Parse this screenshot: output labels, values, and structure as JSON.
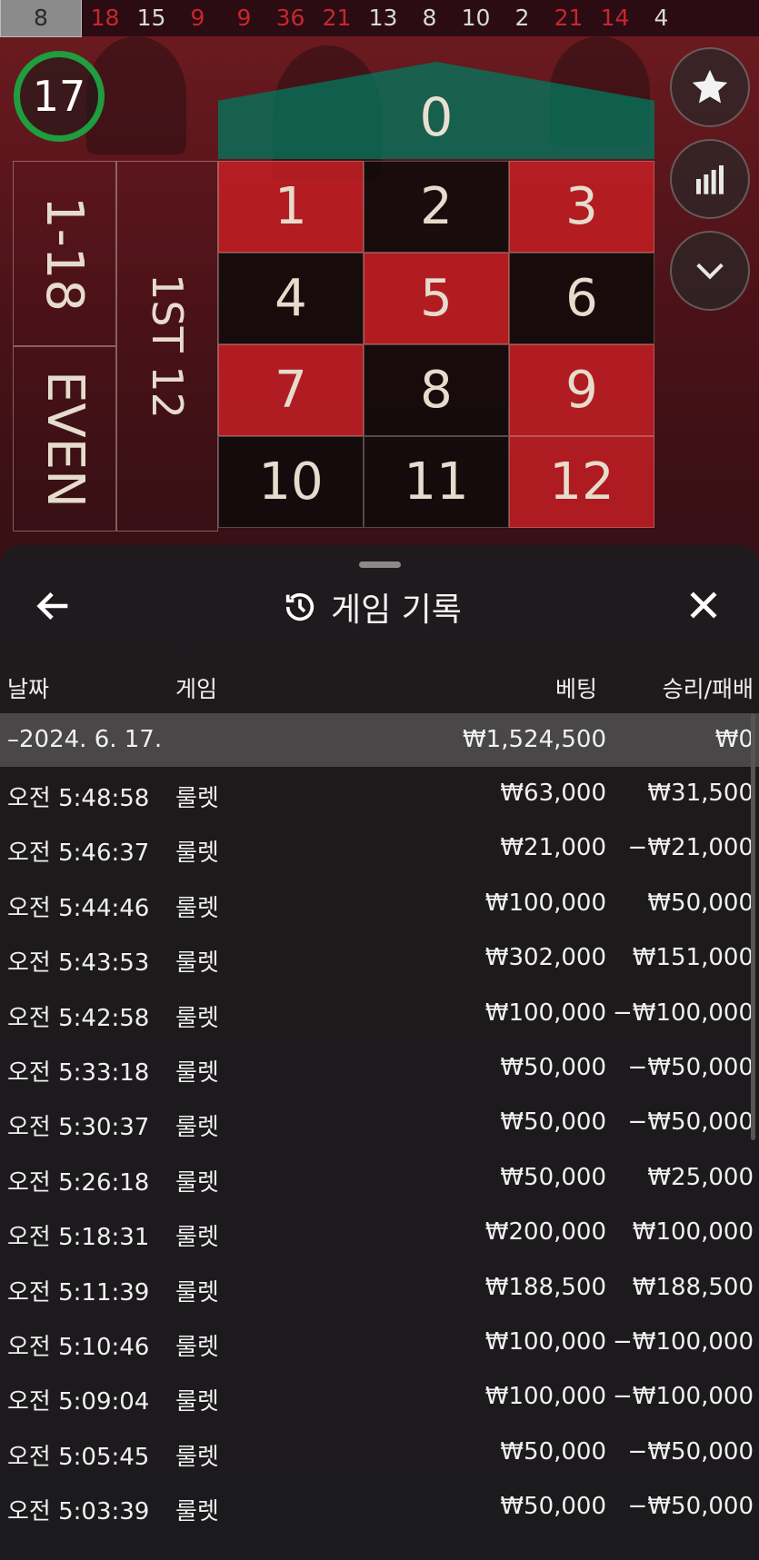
{
  "history": [
    {
      "n": "8",
      "c": "black"
    },
    {
      "n": "18",
      "c": "red"
    },
    {
      "n": "15",
      "c": "black"
    },
    {
      "n": "9",
      "c": "red"
    },
    {
      "n": "9",
      "c": "red"
    },
    {
      "n": "36",
      "c": "red"
    },
    {
      "n": "21",
      "c": "red"
    },
    {
      "n": "13",
      "c": "black"
    },
    {
      "n": "8",
      "c": "black"
    },
    {
      "n": "10",
      "c": "black"
    },
    {
      "n": "2",
      "c": "black"
    },
    {
      "n": "21",
      "c": "red"
    },
    {
      "n": "14",
      "c": "red"
    },
    {
      "n": "4",
      "c": "black"
    }
  ],
  "timer": {
    "seconds": "17",
    "color": "#1f9d3f"
  },
  "board": {
    "zero": "0",
    "cells": [
      {
        "n": "1",
        "c": "red"
      },
      {
        "n": "2",
        "c": "black"
      },
      {
        "n": "3",
        "c": "red"
      },
      {
        "n": "4",
        "c": "black"
      },
      {
        "n": "5",
        "c": "red"
      },
      {
        "n": "6",
        "c": "black"
      },
      {
        "n": "7",
        "c": "red"
      },
      {
        "n": "8",
        "c": "black"
      },
      {
        "n": "9",
        "c": "red"
      },
      {
        "n": "10",
        "c": "black"
      },
      {
        "n": "11",
        "c": "black"
      },
      {
        "n": "12",
        "c": "red"
      }
    ],
    "low_label": "1-18",
    "even_label": "EVEN",
    "dozen_label": "1ST 12"
  },
  "side_buttons": [
    {
      "icon": "star-icon"
    },
    {
      "icon": "stats-icon"
    },
    {
      "icon": "chevron-down-icon"
    }
  ],
  "panel": {
    "title": "게임 기록",
    "title_icon": "history-icon",
    "columns": {
      "date": "날짜",
      "game": "게임",
      "bet": "베팅",
      "win": "승리/패배"
    },
    "date_group": {
      "date": "–2024. 6. 17.",
      "bet": "₩1,524,500",
      "win": "₩0"
    },
    "rows": [
      {
        "time": "오전 5:48:58",
        "game": "룰렛",
        "bet": "₩63,000",
        "win": "₩31,500"
      },
      {
        "time": "오전 5:46:37",
        "game": "룰렛",
        "bet": "₩21,000",
        "win": "−₩21,000"
      },
      {
        "time": "오전 5:44:46",
        "game": "룰렛",
        "bet": "₩100,000",
        "win": "₩50,000"
      },
      {
        "time": "오전 5:43:53",
        "game": "룰렛",
        "bet": "₩302,000",
        "win": "₩151,000"
      },
      {
        "time": "오전 5:42:58",
        "game": "룰렛",
        "bet": "₩100,000",
        "win": "−₩100,000"
      },
      {
        "time": "오전 5:33:18",
        "game": "룰렛",
        "bet": "₩50,000",
        "win": "−₩50,000"
      },
      {
        "time": "오전 5:30:37",
        "game": "룰렛",
        "bet": "₩50,000",
        "win": "−₩50,000"
      },
      {
        "time": "오전 5:26:18",
        "game": "룰렛",
        "bet": "₩50,000",
        "win": "₩25,000"
      },
      {
        "time": "오전 5:18:31",
        "game": "룰렛",
        "bet": "₩200,000",
        "win": "₩100,000"
      },
      {
        "time": "오전 5:11:39",
        "game": "룰렛",
        "bet": "₩188,500",
        "win": "₩188,500"
      },
      {
        "time": "오전 5:10:46",
        "game": "룰렛",
        "bet": "₩100,000",
        "win": "−₩100,000"
      },
      {
        "time": "오전 5:09:04",
        "game": "룰렛",
        "bet": "₩100,000",
        "win": "−₩100,000"
      },
      {
        "time": "오전 5:05:45",
        "game": "룰렛",
        "bet": "₩50,000",
        "win": "−₩50,000"
      },
      {
        "time": "오전 5:03:39",
        "game": "룰렛",
        "bet": "₩50,000",
        "win": "−₩50,000"
      }
    ]
  }
}
